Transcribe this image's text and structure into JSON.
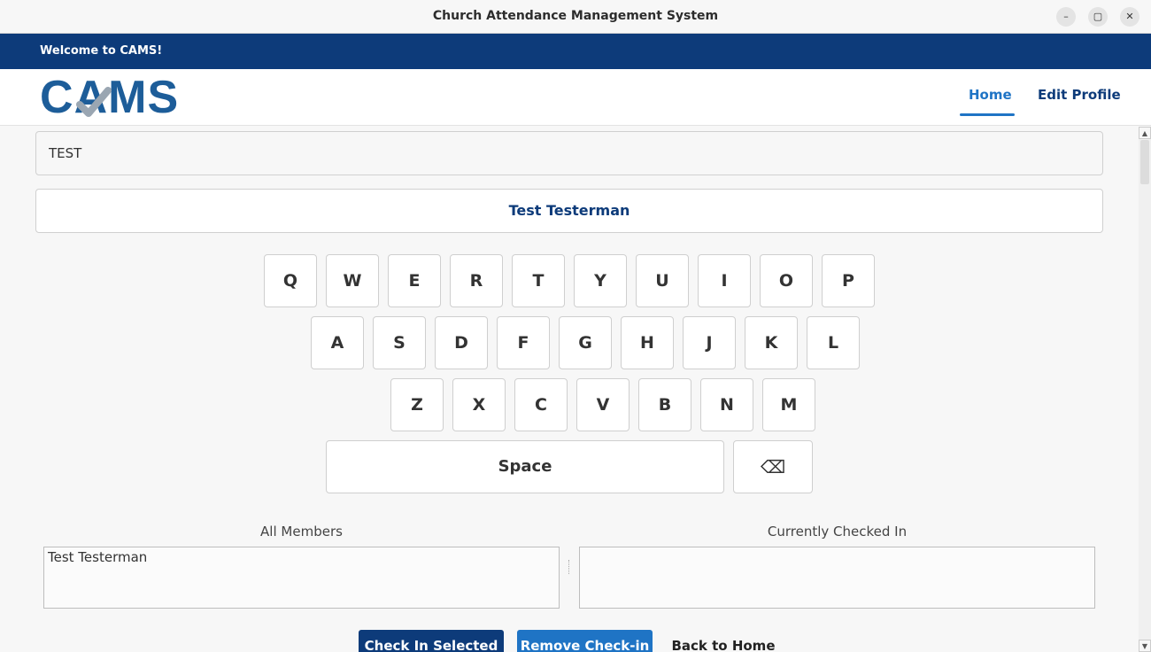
{
  "window": {
    "title": "Church Attendance Management System",
    "controls": {
      "minimize": "–",
      "maximize": "▢",
      "close": "✕"
    }
  },
  "banner": {
    "text": "Welcome to CAMS!"
  },
  "navbar": {
    "logo_text": "CAMS",
    "links": {
      "home": "Home",
      "edit_profile": "Edit Profile"
    },
    "active": "Home"
  },
  "search": {
    "value": "TEST"
  },
  "selected_member": {
    "name": "Test Testerman"
  },
  "keyboard": {
    "row1": [
      "Q",
      "W",
      "E",
      "R",
      "T",
      "Y",
      "U",
      "I",
      "O",
      "P"
    ],
    "row2": [
      "A",
      "S",
      "D",
      "F",
      "G",
      "H",
      "J",
      "K",
      "L"
    ],
    "row3": [
      "Z",
      "X",
      "C",
      "V",
      "B",
      "N",
      "M"
    ],
    "space": "Space",
    "backspace": "⌫"
  },
  "lists": {
    "all_members": {
      "label": "All Members",
      "items": [
        "Test Testerman"
      ]
    },
    "checked_in": {
      "label": "Currently Checked In",
      "items": []
    }
  },
  "buttons": {
    "check_in": "Check In Selected",
    "remove": "Remove Check-in",
    "back": "Back to Home"
  },
  "colors": {
    "primary": "#0d3b7a",
    "accent": "#1f74c5",
    "logo_blue": "#1d5d99"
  }
}
